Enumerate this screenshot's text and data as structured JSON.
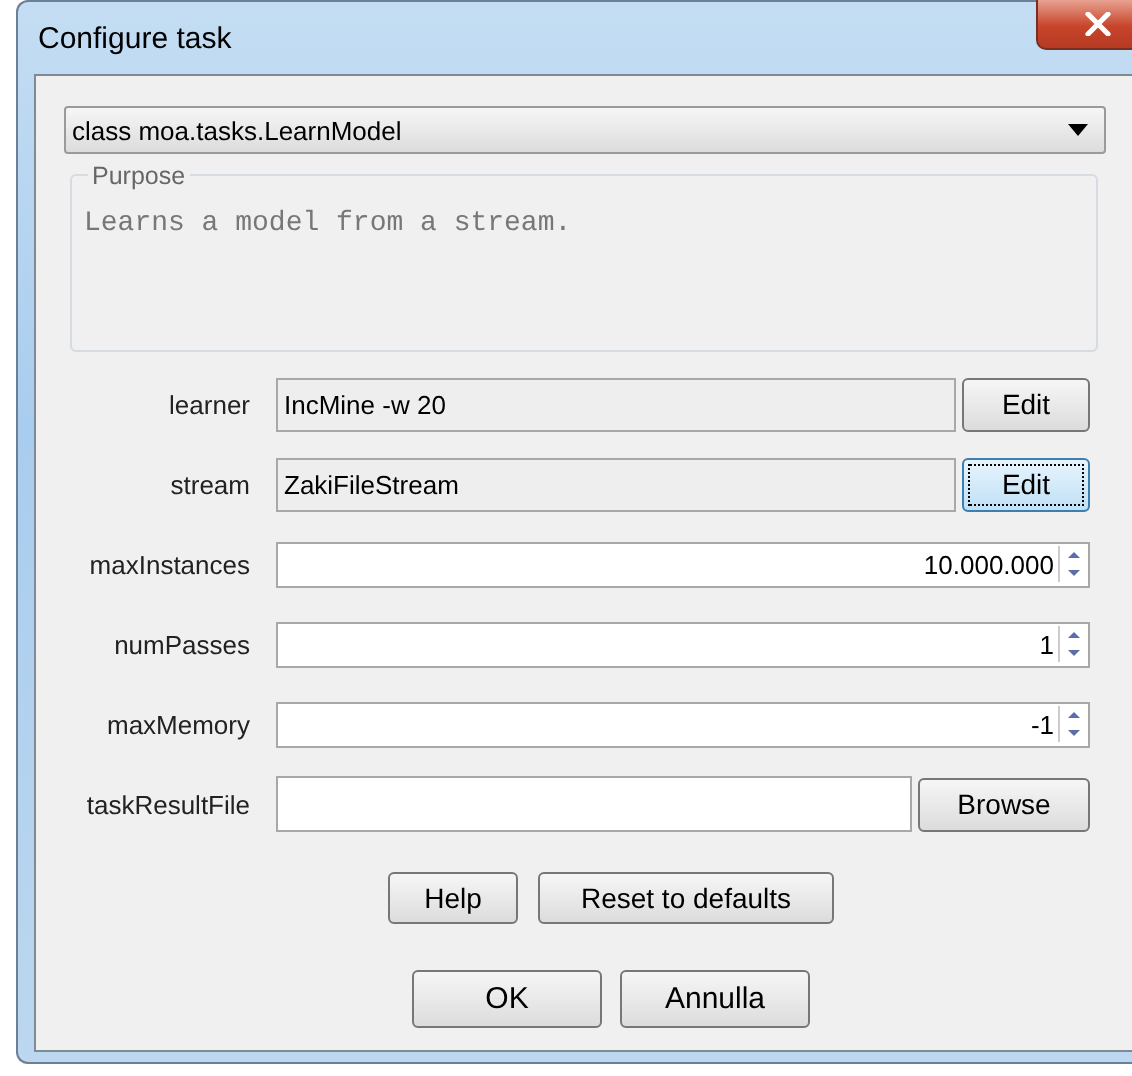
{
  "window": {
    "title": "Configure task"
  },
  "task_class": {
    "value": "class moa.tasks.LearnModel"
  },
  "purpose": {
    "legend": "Purpose",
    "text": "Learns a model from a stream."
  },
  "options": [
    {
      "kind": "object",
      "label": "learner",
      "value": "IncMine -w 20",
      "button": "Edit",
      "focused": false
    },
    {
      "kind": "object",
      "label": "stream",
      "value": "ZakiFileStream",
      "button": "Edit",
      "focused": true
    },
    {
      "kind": "spinner",
      "label": "maxInstances",
      "value": "10.000.000"
    },
    {
      "kind": "spinner",
      "label": "numPasses",
      "value": "1"
    },
    {
      "kind": "spinner",
      "label": "maxMemory",
      "value": "-1"
    },
    {
      "kind": "file",
      "label": "taskResultFile",
      "button": "Browse",
      "focused": false
    }
  ],
  "helper_buttons": [
    "Help",
    "Reset to defaults"
  ],
  "dialog_buttons": [
    "OK",
    "Annulla"
  ]
}
